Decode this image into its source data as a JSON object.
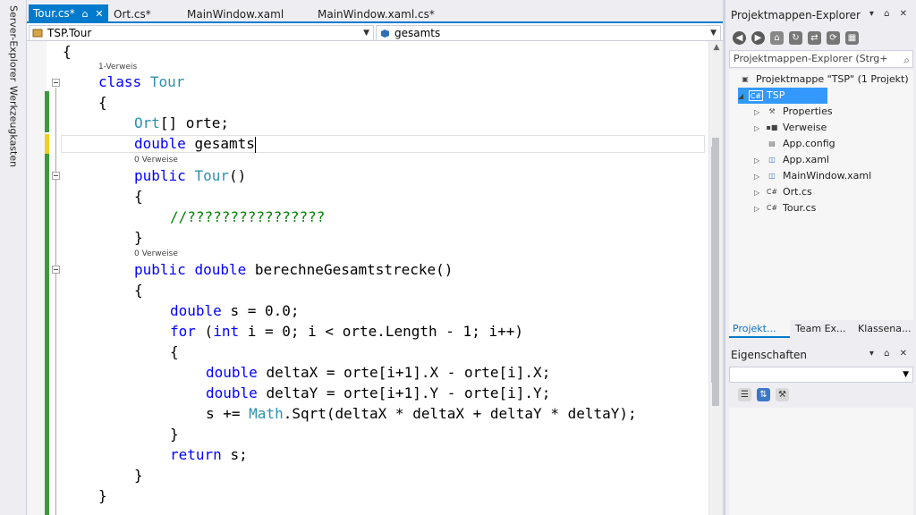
{
  "left_strip": {
    "server_explorer": "Server-Explorer",
    "toolbox": "Werkzeugkasten"
  },
  "doc_tabs": [
    {
      "label": "Tour.cs*",
      "pin": "⌂",
      "close": "✕"
    },
    {
      "label": "Ort.cs*"
    },
    {
      "label": "MainWindow.xaml"
    },
    {
      "label": "MainWindow.xaml.cs*"
    }
  ],
  "nav": {
    "left": "TSP.Tour",
    "right": "gesamts"
  },
  "code": {
    "l1": "{",
    "lens1": "1-Verweis",
    "l2_kw": "class",
    "l2_ty": "Tour",
    "l3": "{",
    "l4_ty": "Ort",
    "l4_rest": "[] orte;",
    "l5_kw": "double",
    "l5_rest": "gesamts",
    "lens2": "0 Verweise",
    "l6_kw": "public",
    "l6_ty": "Tour",
    "l6_rest": "()",
    "l7": "{",
    "l8": "//????????????????",
    "l9": "}",
    "lens3": "0 Verweise",
    "l10_kw1": "public",
    "l10_kw2": "double",
    "l10_rest": "berechneGesamtstrecke()",
    "l11": "{",
    "l12_kw": "double",
    "l12_rest": "s = 0.0;",
    "l13_kw1": "for",
    "l13_p1": "(",
    "l13_kw2": "int",
    "l13_rest": "i = 0; i < orte.Length - 1; i++)",
    "l14": "{",
    "l15_kw": "double",
    "l15_rest": "deltaX = orte[i+1].X - orte[i].X;",
    "l16_kw": "double",
    "l16_rest": "deltaY = orte[i+1].Y - orte[i].Y;",
    "l17_a": "s += ",
    "l17_ty": "Math",
    "l17_b": ".Sqrt(deltaX * deltaX + deltaY * deltaY);",
    "l18": "}",
    "l19_kw": "return",
    "l19_rest": "s;",
    "l20": "}",
    "l21": "}"
  },
  "solution_explorer": {
    "title": "Projektmappen-Explorer",
    "title_btns": "▾ ⌂ ✕",
    "search_placeholder": "Projektmappen-Explorer (Strg+",
    "search_icon": "⌕",
    "items": [
      {
        "label": "Projektmappe \"TSP\" (1 Projekt)"
      },
      {
        "label": "TSP"
      },
      {
        "label": "Properties"
      },
      {
        "label": "Verweise"
      },
      {
        "label": "App.config"
      },
      {
        "label": "App.xaml"
      },
      {
        "label": "MainWindow.xaml"
      },
      {
        "label": "Ort.cs"
      },
      {
        "label": "Tour.cs"
      }
    ],
    "tabs": [
      "Projekt...",
      "Team Ex...",
      "Klassena..."
    ]
  },
  "properties": {
    "title": "Eigenschaften",
    "title_btns": "▾ ⌂ ✕"
  },
  "colors": {
    "accent": "#007acc",
    "keyword": "#0000ff",
    "type": "#2b91af",
    "comment": "#008000",
    "change_saved": "#3c9a3c",
    "change_unsaved": "#f0d020"
  }
}
